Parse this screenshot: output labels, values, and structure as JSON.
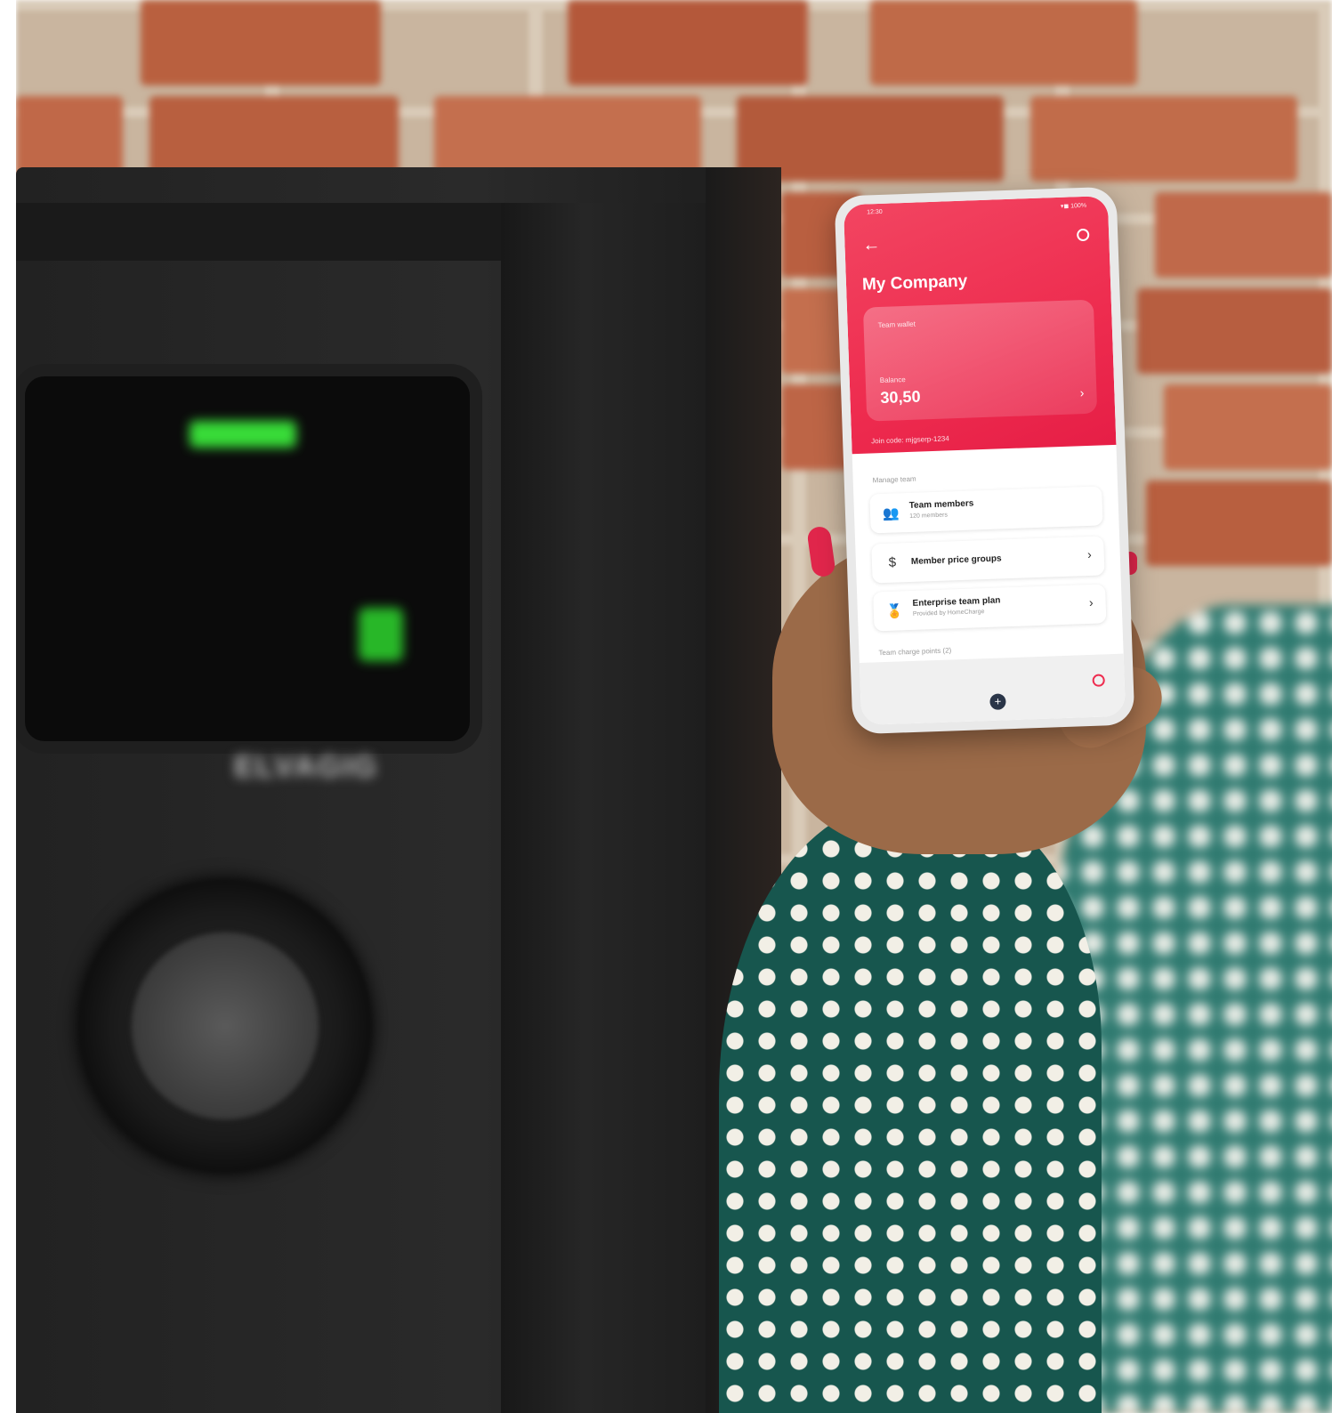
{
  "app": {
    "status_time": "12:30",
    "status_icons": "▾◼ 100%",
    "back_icon": "arrow-left-icon",
    "settings_icon": "gear-icon",
    "title": "My Company",
    "wallet": {
      "label": "Team wallet",
      "balance_label": "Balance",
      "balance_value": "30,50",
      "chevron": "›"
    },
    "join_code_text": "Join code: mjgserp-1234",
    "manage_heading": "Manage team",
    "rows": [
      {
        "icon": "people-icon",
        "glyph": "👥",
        "label": "Team members",
        "sub": "120 members",
        "chevron": ""
      },
      {
        "icon": "dollar-icon",
        "glyph": "$",
        "label": "Member price groups",
        "sub": "",
        "chevron": "›"
      },
      {
        "icon": "award-icon",
        "glyph": "🏅",
        "label": "Enterprise team plan",
        "sub": "Provided by HomeCharge",
        "chevron": "›"
      }
    ],
    "points_heading": "Team charge points (2)",
    "map_add_icon": "plus-icon",
    "map_add_glyph": "+"
  },
  "charger": {
    "logo_text": "ELVAGIG"
  },
  "colors": {
    "accent": "#ee2c4f",
    "sleeve": "#17564e"
  }
}
